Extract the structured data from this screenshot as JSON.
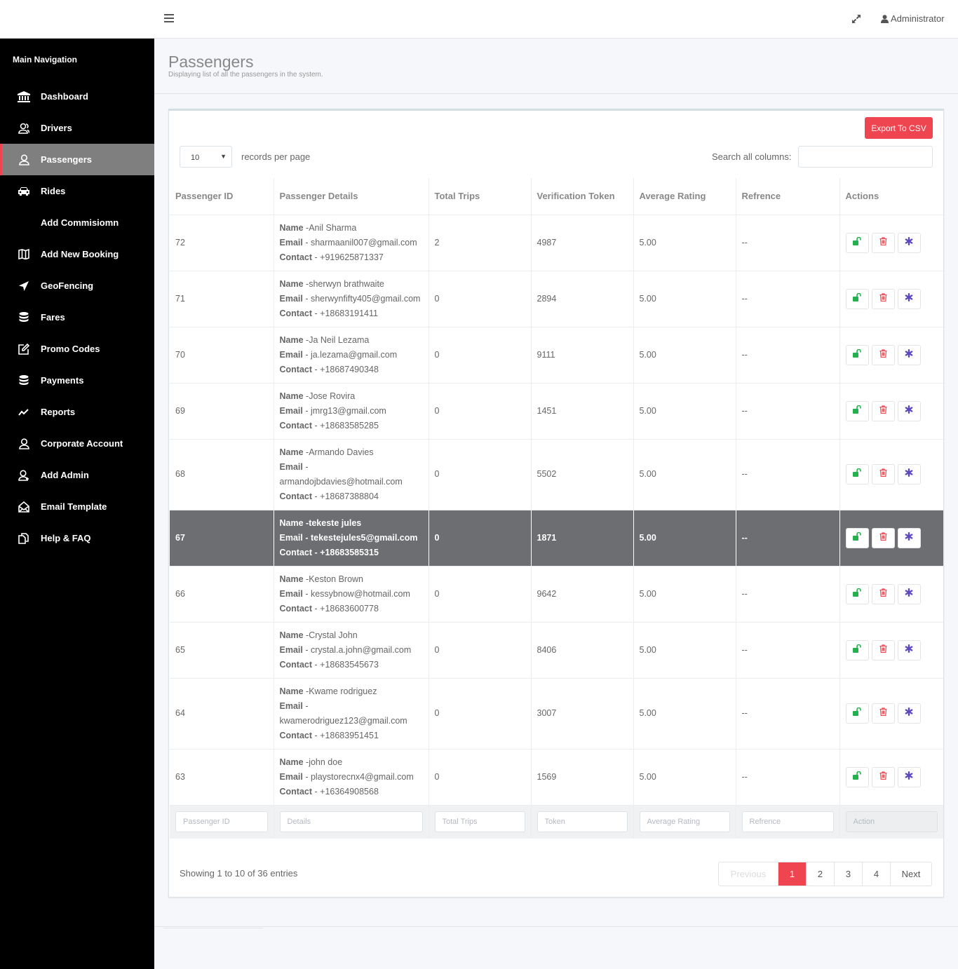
{
  "topbar": {
    "user_label": "Administrator"
  },
  "sidebar": {
    "header": "Main Navigation",
    "items": [
      {
        "label": "Dashboard",
        "icon": "bank-icon"
      },
      {
        "label": "Drivers",
        "icon": "users-icon"
      },
      {
        "label": "Passengers",
        "icon": "user-icon",
        "active": true
      },
      {
        "label": "Rides",
        "icon": "car-icon"
      },
      {
        "label": "Add Commisiomn",
        "icon": ""
      },
      {
        "label": "Add New Booking",
        "icon": "map-icon"
      },
      {
        "label": "GeoFencing",
        "icon": "location-arrow-icon"
      },
      {
        "label": "Fares",
        "icon": "database-icon"
      },
      {
        "label": "Promo Codes",
        "icon": "edit-icon"
      },
      {
        "label": "Payments",
        "icon": "database-icon"
      },
      {
        "label": "Reports",
        "icon": "line-chart-icon"
      },
      {
        "label": "Corporate Account",
        "icon": "user-icon"
      },
      {
        "label": "Add Admin",
        "icon": "user-plus-icon"
      },
      {
        "label": "Email Template",
        "icon": "envelope-open-icon"
      },
      {
        "label": "Help & FAQ",
        "icon": "copy-icon"
      }
    ]
  },
  "page": {
    "title": "Passengers",
    "subtitle": "Displaying list of all the passengers in the system."
  },
  "toolbar": {
    "export_label": "Export To CSV",
    "page_length": "10",
    "page_length_label": "records per page",
    "search_label": "Search all columns:",
    "search_value": ""
  },
  "table": {
    "columns": [
      "Passenger ID",
      "Passenger Details",
      "Total Trips",
      "Verification Token",
      "Average Rating",
      "Refrence",
      "Actions"
    ],
    "detail_labels": {
      "name": "Name",
      "email": "Email",
      "contact": "Contact"
    },
    "rows": [
      {
        "id": "72",
        "name": "Anil Sharma",
        "email": "sharmaanil007@gmail.com",
        "contact": "+919625871337",
        "trips": "2",
        "token": "4987",
        "rating": "5.00",
        "reference": "--"
      },
      {
        "id": "71",
        "name": "sherwyn brathwaite",
        "email": "sherwynfifty405@gmail.com",
        "contact": "+18683191411",
        "trips": "0",
        "token": "2894",
        "rating": "5.00",
        "reference": "--"
      },
      {
        "id": "70",
        "name": "Ja Neil Lezama",
        "email": "ja.lezama@gmail.com",
        "contact": "+18687490348",
        "trips": "0",
        "token": "9111",
        "rating": "5.00",
        "reference": "--"
      },
      {
        "id": "69",
        "name": "Jose Rovira",
        "email": "jmrg13@gmail.com",
        "contact": "+18683585285",
        "trips": "0",
        "token": "1451",
        "rating": "5.00",
        "reference": "--"
      },
      {
        "id": "68",
        "name": "Armando Davies",
        "email": "armandojbdavies@hotmail.com",
        "contact": "+18687388804",
        "trips": "0",
        "token": "5502",
        "rating": "5.00",
        "reference": "--"
      },
      {
        "id": "67",
        "name": "tekeste jules",
        "email": "tekestejules5@gmail.com",
        "contact": "+18683585315",
        "trips": "0",
        "token": "1871",
        "rating": "5.00",
        "reference": "--",
        "selected": true
      },
      {
        "id": "66",
        "name": "Keston Brown",
        "email": "kessybnow@hotmail.com",
        "contact": "+18683600778",
        "trips": "0",
        "token": "9642",
        "rating": "5.00",
        "reference": "--"
      },
      {
        "id": "65",
        "name": "Crystal John",
        "email": "crystal.a.john@gmail.com",
        "contact": "+18683545673",
        "trips": "0",
        "token": "8406",
        "rating": "5.00",
        "reference": "--"
      },
      {
        "id": "64",
        "name": "Kwame rodriguez",
        "email": "kwamerodriguez123@gmail.com",
        "contact": "+18683951451",
        "trips": "0",
        "token": "3007",
        "rating": "5.00",
        "reference": "--"
      },
      {
        "id": "63",
        "name": "john doe",
        "email": "playstorecnx4@gmail.com",
        "contact": "+16364908568",
        "trips": "0",
        "token": "1569",
        "rating": "5.00",
        "reference": "--"
      }
    ],
    "filters": [
      "Passenger ID",
      "Details",
      "Total Trips",
      "Token",
      "Average Rating",
      "Refrence",
      "Action"
    ]
  },
  "footer": {
    "info": "Showing 1 to 10 of 36 entries",
    "pagination": {
      "previous": "Previous",
      "pages": [
        "1",
        "2",
        "3",
        "4"
      ],
      "current": "1",
      "next": "Next"
    }
  },
  "colors": {
    "accent": "#ef4550",
    "sidebar_bg": "#000000",
    "sidebar_active": "#7f7f7f",
    "selected_row": "#6d6e71",
    "unlock_icon": "#22b14c",
    "delete_icon": "#ef4550",
    "reset_icon": "#5b4bbf"
  }
}
